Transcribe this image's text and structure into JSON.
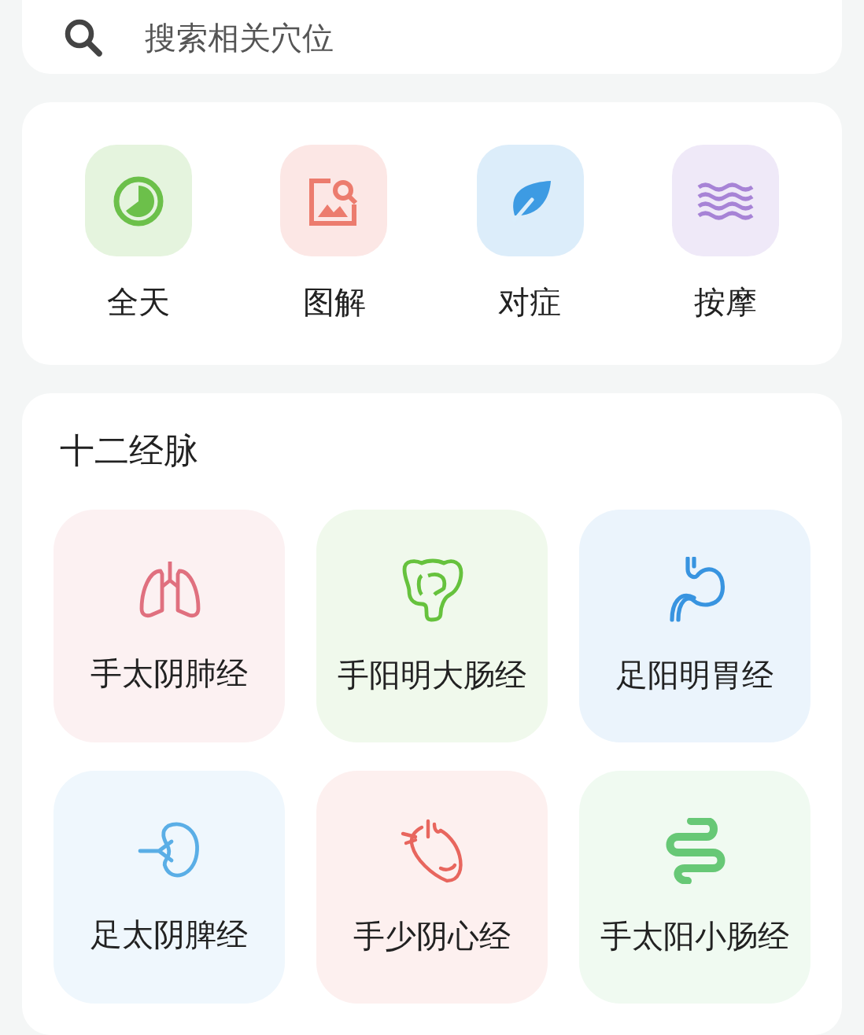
{
  "search": {
    "placeholder": "搜索相关穴位"
  },
  "shortcuts": [
    {
      "label": "全天",
      "color": "#6cc04a"
    },
    {
      "label": "图解",
      "color": "#ec7c6e"
    },
    {
      "label": "对症",
      "color": "#3d9be3"
    },
    {
      "label": "按摩",
      "color": "#a783d6"
    }
  ],
  "meridians": {
    "title": "十二经脉",
    "items": [
      {
        "label": "手太阴肺经",
        "color": "#e0707f"
      },
      {
        "label": "手阳明大肠经",
        "color": "#66c23d"
      },
      {
        "label": "足阳明胃经",
        "color": "#3894e0"
      },
      {
        "label": "足太阴脾经",
        "color": "#5aaee6"
      },
      {
        "label": "手少阴心经",
        "color": "#e8665e"
      },
      {
        "label": "手太阳小肠经",
        "color": "#67c876"
      }
    ]
  }
}
